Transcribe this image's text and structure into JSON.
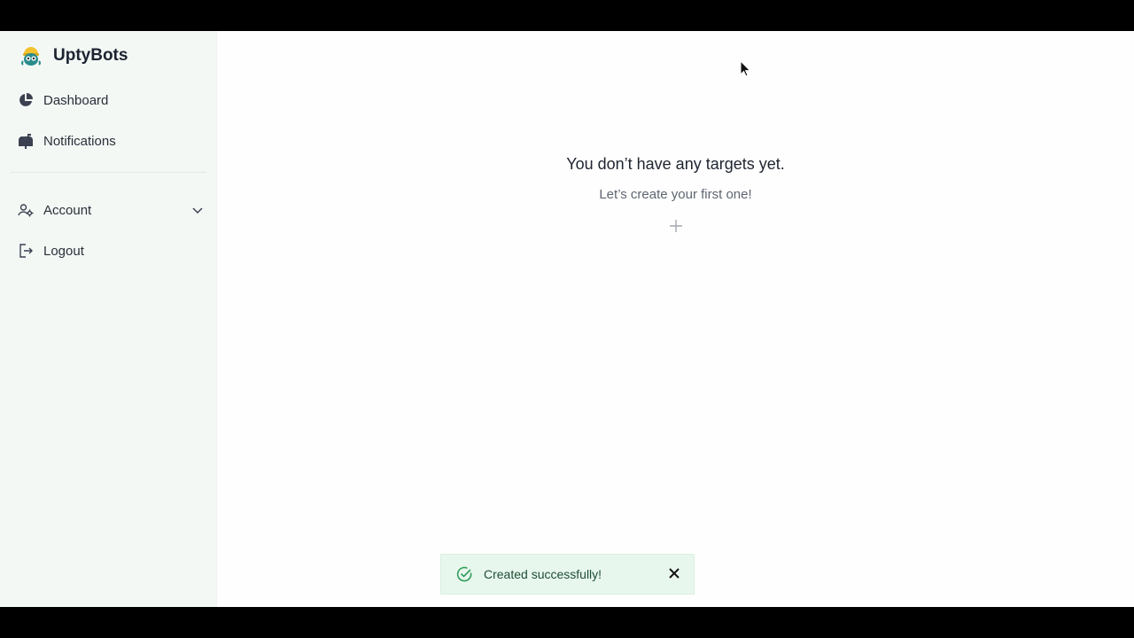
{
  "app": {
    "name": "UptyBots"
  },
  "sidebar": {
    "items": [
      {
        "label": "Dashboard",
        "icon": "pie-chart-icon"
      },
      {
        "label": "Notifications",
        "icon": "mailbox-icon"
      },
      {
        "label": "Account",
        "icon": "user-settings-icon"
      },
      {
        "label": "Logout",
        "icon": "logout-icon"
      }
    ]
  },
  "main": {
    "empty_title": "You don’t have any targets yet.",
    "empty_subtitle": "Let’s create your first one!",
    "add_icon": "plus-icon"
  },
  "toast": {
    "message": "Created successfully!",
    "icon": "check-circle-icon",
    "close_icon": "close-icon"
  },
  "colors": {
    "sidebar_bg": "#f3f8f5",
    "main_bg": "#fdfefd",
    "toast_bg": "#e8f7ee",
    "success": "#2f9e5b",
    "text_primary": "#1f2430"
  }
}
